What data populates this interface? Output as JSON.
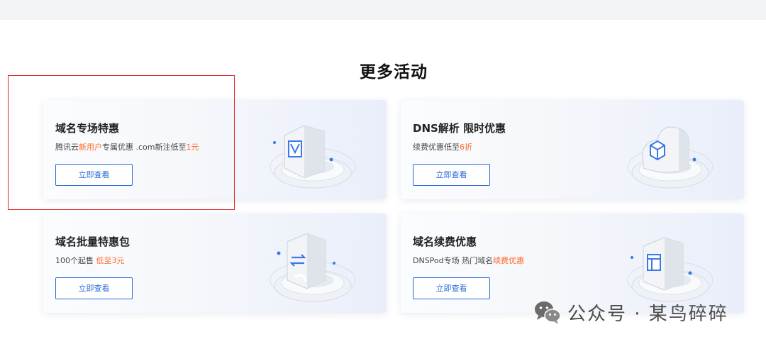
{
  "section": {
    "title": "更多活动"
  },
  "cards": [
    {
      "title": "域名专场特惠",
      "desc": [
        {
          "text": "腾讯云",
          "highlight": false
        },
        {
          "text": "新用户",
          "highlight": true
        },
        {
          "text": "专属优惠 .com新注低至",
          "highlight": false
        },
        {
          "text": "1元",
          "highlight": true
        }
      ],
      "button": "立即查看",
      "icon": "tag-badge-icon"
    },
    {
      "title": "DNS解析 限时优惠",
      "desc": [
        {
          "text": "续费优惠低至",
          "highlight": false
        },
        {
          "text": "6折",
          "highlight": true
        }
      ],
      "button": "立即查看",
      "icon": "cloud-cube-icon"
    },
    {
      "title": "域名批量特惠包",
      "desc": [
        {
          "text": "100个起售 ",
          "highlight": false
        },
        {
          "text": "低至3元",
          "highlight": true
        }
      ],
      "button": "立即查看",
      "icon": "transfer-arrows-icon"
    },
    {
      "title": "域名续费优惠",
      "desc": [
        {
          "text": "DNSPod专场 热门域名",
          "highlight": false
        },
        {
          "text": "续费优惠",
          "highlight": true
        }
      ],
      "button": "立即查看",
      "icon": "window-box-icon"
    }
  ],
  "watermark": {
    "text": "公众号 · 某鸟碎碎",
    "icon": "wechat-icon"
  },
  "colors": {
    "accent": "#2b6bd6",
    "highlight": "#ff6b2c",
    "annotation": "#e0262b"
  }
}
